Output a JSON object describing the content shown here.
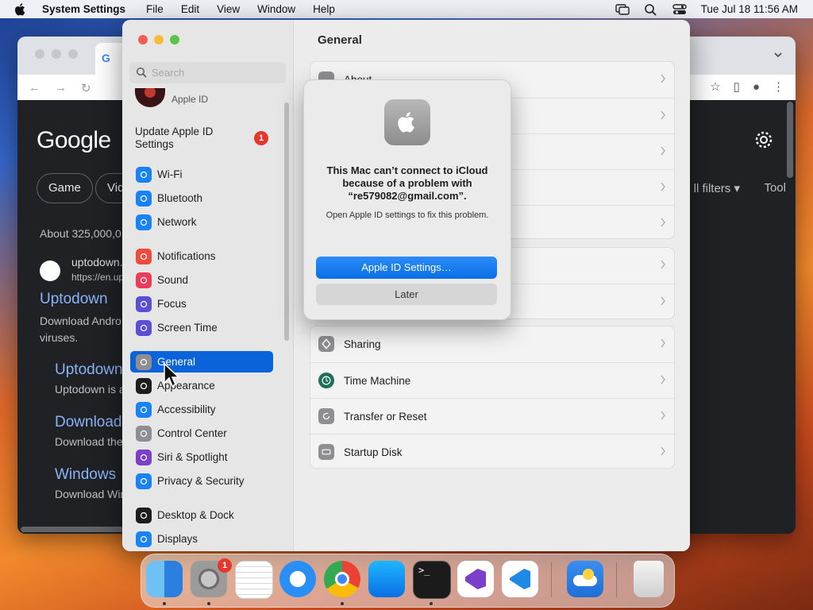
{
  "menubar": {
    "app_name": "System Settings",
    "menus": [
      "File",
      "Edit",
      "View",
      "Window",
      "Help"
    ],
    "clock": "Tue Jul 18  11:56 AM"
  },
  "chrome": {
    "tab_favicon": "G",
    "logo_text": "Google",
    "chips": [
      "Game",
      "Vid"
    ],
    "all_filters": "ll filters ▾",
    "tools": "Tool",
    "result_count": "About 325,000,0",
    "result1_site": "uptodown.",
    "result1_url": "https://en.up",
    "result1_title": "Uptodown",
    "result1_desc": [
      "Download Andro",
      "viruses."
    ],
    "sub1_title": "Uptodown",
    "sub1_desc": "Uptodown is a",
    "sub2_title": "Download",
    "sub2_desc": "Download the",
    "sub3_title": "Windows",
    "sub3_desc": "Download Win"
  },
  "settings": {
    "search_placeholder": "Search",
    "apple_id_label": "Apple ID",
    "update_apple_id": "Update Apple ID Settings",
    "update_badge": "1",
    "sidebar_items": [
      {
        "label": "Wi-Fi",
        "icon": "wifi-icon",
        "color": "#1a82f7"
      },
      {
        "label": "Bluetooth",
        "icon": "bluetooth-icon",
        "color": "#1a82f7"
      },
      {
        "label": "Network",
        "icon": "globe-icon",
        "color": "#1a82f7"
      },
      {
        "label": "Notifications",
        "icon": "bell-icon",
        "color": "#ef4a3b"
      },
      {
        "label": "Sound",
        "icon": "speaker-icon",
        "color": "#ef3b5a"
      },
      {
        "label": "Focus",
        "icon": "moon-icon",
        "color": "#5b4fd6"
      },
      {
        "label": "Screen Time",
        "icon": "hourglass-icon",
        "color": "#5b4fd6"
      },
      {
        "label": "General",
        "icon": "gear-icon",
        "color": "#8e8e93"
      },
      {
        "label": "Appearance",
        "icon": "appearance-icon",
        "color": "#1d1d1d"
      },
      {
        "label": "Accessibility",
        "icon": "accessibility-icon",
        "color": "#1a82f7"
      },
      {
        "label": "Control Center",
        "icon": "toggles-icon",
        "color": "#8e8e93"
      },
      {
        "label": "Siri & Spotlight",
        "icon": "siri-icon",
        "color": "#7b3fc9"
      },
      {
        "label": "Privacy & Security",
        "icon": "hand-icon",
        "color": "#1a82f7"
      },
      {
        "label": "Desktop & Dock",
        "icon": "dock-icon",
        "color": "#1d1d1d"
      },
      {
        "label": "Displays",
        "icon": "sun-icon",
        "color": "#1a82f7"
      }
    ],
    "main_title": "General",
    "rows_top": [
      "About",
      "",
      "",
      "",
      ""
    ],
    "rows_mid": [
      "",
      ""
    ],
    "rows_bottom": [
      "Sharing",
      "Time Machine",
      "Transfer or Reset",
      "Startup Disk"
    ]
  },
  "alert": {
    "title": "This Mac can’t connect to iCloud because of a problem with “re579082@gmail.com”.",
    "message": "Open Apple ID settings to fix this problem.",
    "primary_button": "Apple ID Settings…",
    "secondary_button": "Later"
  },
  "dock": {
    "settings_badge": "1",
    "apps": [
      "Finder",
      "System Settings",
      "TextEdit",
      "Safari",
      "Google Chrome",
      "App Store",
      "Terminal",
      "Visual Studio",
      "Visual Studio Code",
      "Weather",
      "Trash"
    ]
  }
}
